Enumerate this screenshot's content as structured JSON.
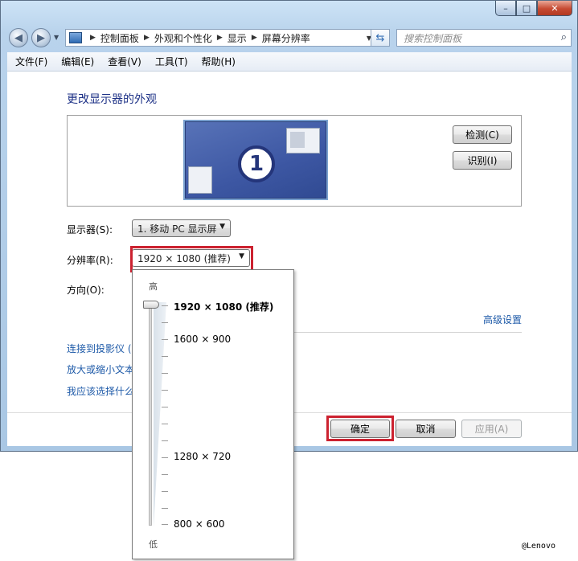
{
  "window": {
    "caption_buttons": {
      "minimize": "–",
      "maximize": "□",
      "close": "✕"
    }
  },
  "nav": {
    "back_icon": "back-arrow-icon",
    "forward_icon": "forward-arrow-icon",
    "breadcrumb": [
      "控制面板",
      "外观和个性化",
      "显示",
      "屏幕分辨率"
    ],
    "search_placeholder": "搜索控制面板"
  },
  "menu": [
    "文件(F)",
    "编辑(E)",
    "查看(V)",
    "工具(T)",
    "帮助(H)"
  ],
  "main": {
    "title": "更改显示器的外观",
    "monitor_number": "1",
    "detect_button": "检测(C)",
    "identify_button": "识别(I)",
    "display_label": "显示器(S):",
    "display_value": "1. 移动 PC 显示屏",
    "resolution_label": "分辨率(R):",
    "resolution_value": "1920 × 1080 (推荐)",
    "orientation_label": "方向(O):",
    "advanced_link": "高级设置",
    "links": [
      "连接到投影仪 (",
      "放大或缩小文本",
      "我应该选择什么"
    ],
    "ok_button": "确定",
    "cancel_button": "取消",
    "apply_button": "应用(A)"
  },
  "resolution_popup": {
    "high_label": "高",
    "low_label": "低",
    "options": [
      "1920 × 1080 (推荐)",
      "1600 × 900",
      "1280 × 720",
      "800 × 600"
    ],
    "selected_option": "1920 × 1080 (推荐)"
  },
  "watermark": "@Lenovo",
  "colors": {
    "highlight_border": "#cc2230",
    "link": "#1e5aa8",
    "title": "#1e3287"
  }
}
